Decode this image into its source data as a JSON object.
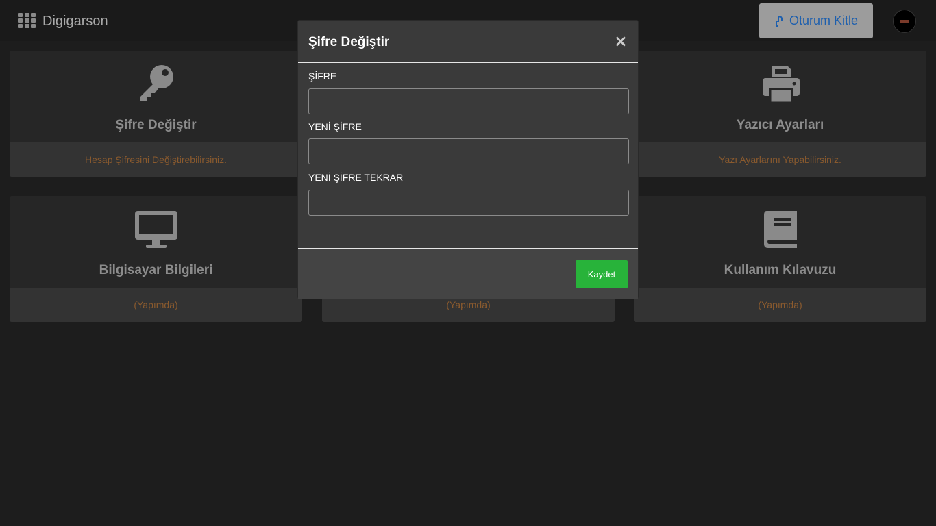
{
  "app": {
    "brand": "Digigarson",
    "lock_button": "Oturum Kitle"
  },
  "cards": [
    {
      "title": "Şifre Değiştir",
      "footer": "Hesap Şifresini Değiştirebilirsiniz.",
      "icon": "key-icon"
    },
    {
      "title": "Yazıcı Ayarları",
      "footer": "Yazı Ayarlarını Yapabilirsiniz.",
      "icon": "printer-icon"
    },
    {
      "title": "Bilgisayar Bilgileri",
      "footer": "(Yapımda)",
      "icon": "monitor-icon"
    },
    {
      "title": "",
      "footer": "(Yapımda)",
      "icon": ""
    },
    {
      "title": "Kullanım Kılavuzu",
      "footer": "(Yapımda)",
      "icon": "book-icon"
    }
  ],
  "modal": {
    "title": "Şifre Değiştir",
    "close": "×",
    "fields": [
      {
        "label": "ŞİFRE",
        "value": ""
      },
      {
        "label": "YENİ ŞİFRE",
        "value": ""
      },
      {
        "label": "YENİ ŞİFRE TEKRAR",
        "value": ""
      }
    ],
    "save_label": "Kaydet"
  },
  "colors": {
    "background": "#1d1d1d",
    "card": "#262626",
    "card_footer_text": "#8a5a2e",
    "save_button": "#28b33a",
    "lock_button_text": "#1d5fae"
  }
}
